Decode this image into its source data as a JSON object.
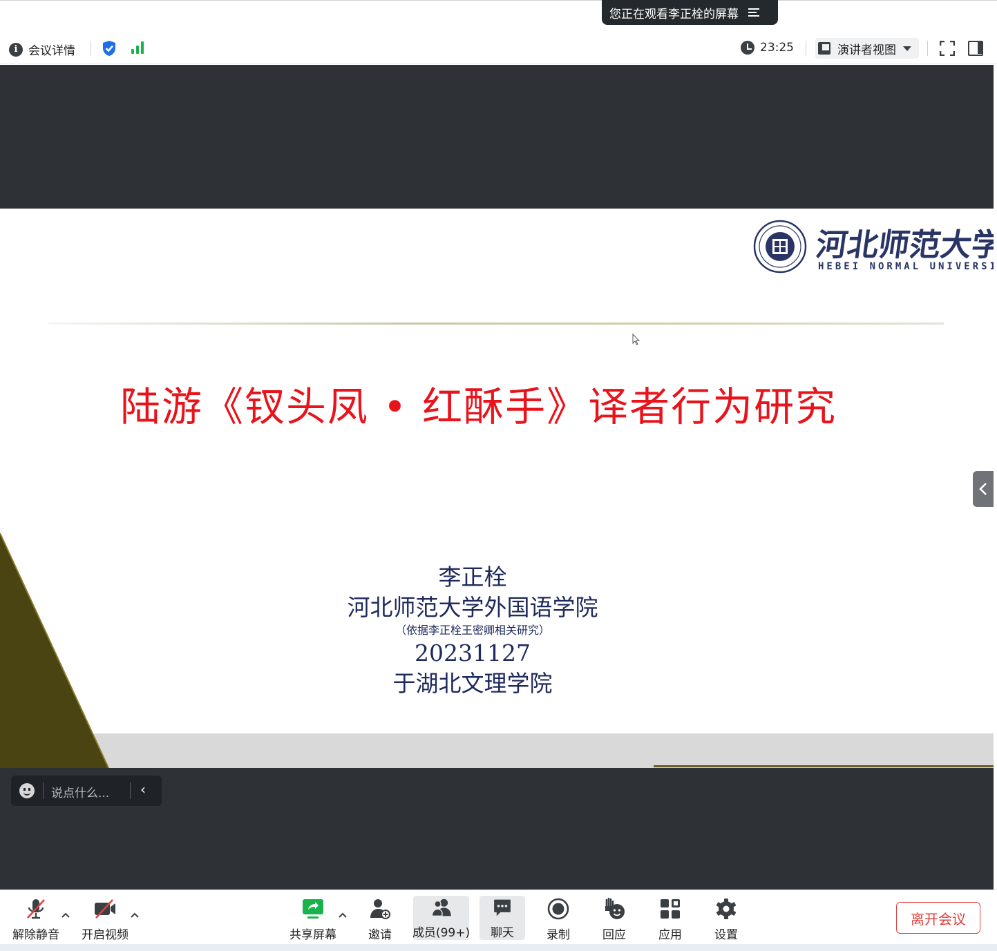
{
  "banner": {
    "viewing_text": "您正在观看李正栓的屏幕"
  },
  "toolbar": {
    "meeting_details_label": "会议详情",
    "clock_time": "23:25",
    "view_mode_label": "演讲者视图"
  },
  "slide": {
    "logo_cn": "河北师范大学",
    "logo_en": "HEBEI NORMAL UNIVERSITY",
    "title": "陆游《钗头凤 • 红酥手》译者行为研究",
    "author": "李正栓",
    "institution": "河北师范大学外国语学院",
    "note": "（依据李正栓王密卿相关研究）",
    "date": "20231127",
    "venue": "于湖北文理学院"
  },
  "chat": {
    "placeholder": "说点什么..."
  },
  "bottom_toolbar": {
    "unmute_label": "解除静音",
    "video_label": "开启视频",
    "share_label": "共享屏幕",
    "invite_label": "邀请",
    "members_label": "成员(99+)",
    "chat_label": "聊天",
    "record_label": "录制",
    "react_label": "回应",
    "apps_label": "应用",
    "settings_label": "设置",
    "leave_label": "离开会议"
  },
  "colors": {
    "accent_green": "#19b34b",
    "shield_blue": "#1e6fe6",
    "title_red": "#e8131b",
    "leave_red": "#e0403b",
    "stage_dark": "#2e3135",
    "triangle_olive": "#4a4312"
  }
}
